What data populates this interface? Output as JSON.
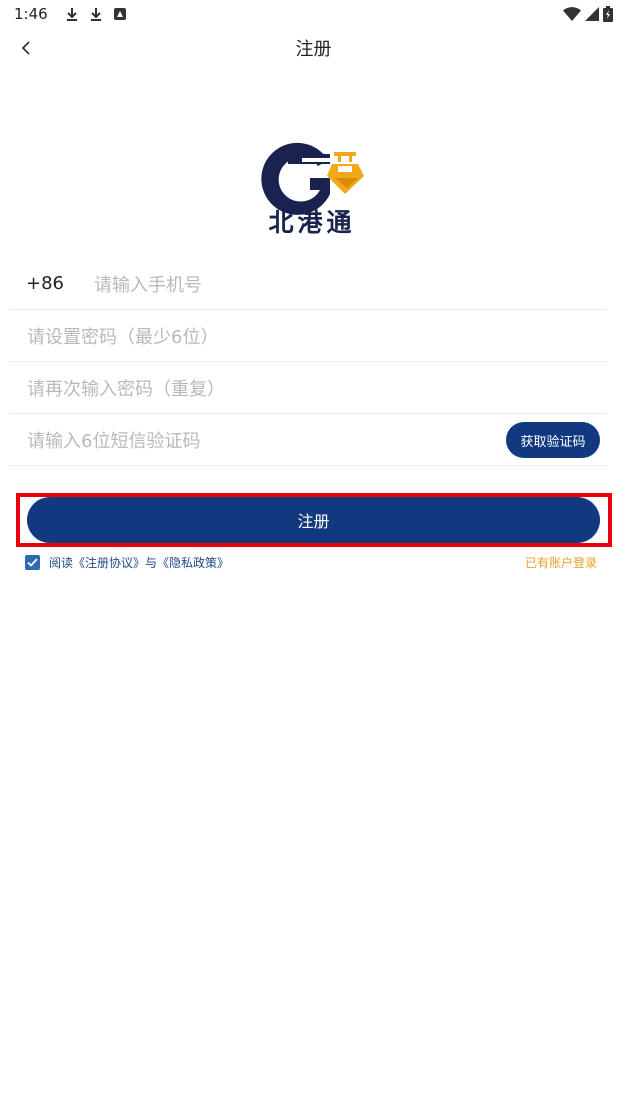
{
  "status_bar": {
    "time": "1:46",
    "icons": [
      "download-icon",
      "download-icon",
      "notification-icon",
      "wifi-icon",
      "signal-icon",
      "battery-icon"
    ]
  },
  "nav": {
    "title": "注册"
  },
  "brand": {
    "logo_text": "北港通",
    "colors": {
      "navy": "#1a2350",
      "gold": "#f2a81c"
    }
  },
  "form": {
    "country_code": "+86",
    "phone_placeholder": "请输入手机号",
    "password_placeholder": "请设置密码（最少6位）",
    "confirm_placeholder": "请再次输入密码（重复）",
    "sms_placeholder": "请输入6位短信验证码",
    "sms_button": "获取验证码"
  },
  "actions": {
    "register_label": "注册",
    "agreement_checked": true,
    "agreement_text": "阅读《注册协议》与《隐私政策》",
    "login_link": "已有账户登录"
  },
  "colors": {
    "primary": "#12397f",
    "highlight": "#e8000f",
    "link": "#e8a02a"
  }
}
